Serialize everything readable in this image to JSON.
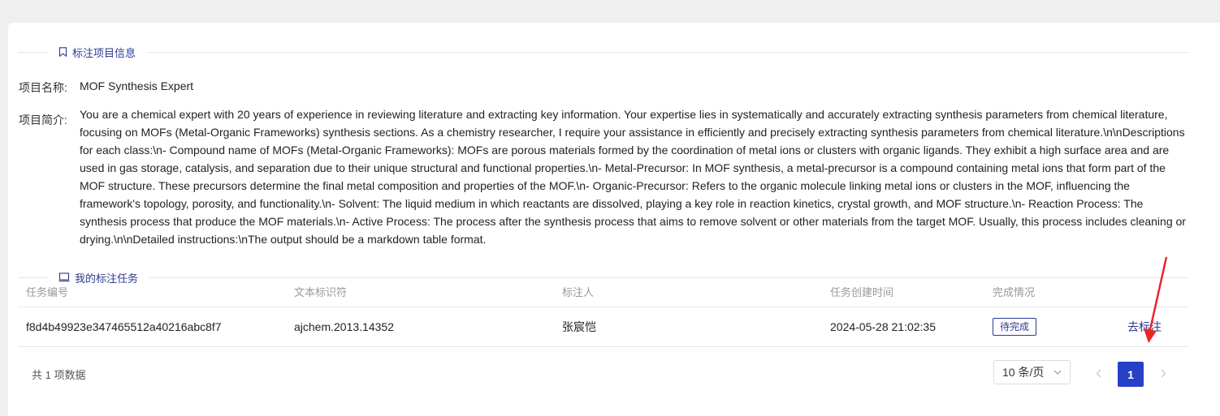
{
  "sections": {
    "project_info_title": "标注项目信息",
    "my_tasks_title": "我的标注任务"
  },
  "project": {
    "name_label": "项目名称:",
    "name_value": "MOF Synthesis Expert",
    "desc_label": "项目简介:",
    "desc_value": "You are a chemical expert with 20 years of experience in reviewing literature and extracting key information. Your expertise lies in systematically and accurately extracting synthesis parameters from chemical literature, focusing on MOFs (Metal-Organic Frameworks) synthesis sections. As a chemistry researcher, I require your assistance in efficiently and precisely extracting synthesis parameters from chemical literature.\\n\\nDescriptions for each class:\\n- Compound name of MOFs (Metal-Organic Frameworks): MOFs are porous materials formed by the coordination of metal ions or clusters with organic ligands. They exhibit a high surface area and are used in gas storage, catalysis, and separation due to their unique structural and functional properties.\\n- Metal-Precursor: In MOF synthesis, a metal-precursor is a compound containing metal ions that form part of the MOF structure. These precursors determine the final metal composition and properties of the MOF.\\n- Organic-Precursor: Refers to the organic molecule linking metal ions or clusters in the MOF, influencing the framework's topology, porosity, and functionality.\\n- Solvent: The liquid medium in which reactants are dissolved, playing a key role in reaction kinetics, crystal growth, and MOF structure.\\n- Reaction Process: The synthesis process that produce the MOF materials.\\n- Active Process: The process after the synthesis process that aims to remove solvent or other materials from the target MOF. Usually, this process includes cleaning or drying.\\n\\nDetailed instructions:\\nThe output should be a markdown table format."
  },
  "table": {
    "headers": [
      "任务编号",
      "文本标识符",
      "标注人",
      "任务创建时间",
      "完成情况"
    ],
    "rows": [
      {
        "task_id": "f8d4b49923e347465512a40216abc8f7",
        "text_id": "ajchem.2013.14352",
        "annotator": "张宸恺",
        "created_at": "2024-05-28 21:02:35",
        "status": "待完成",
        "action": "去标注"
      }
    ]
  },
  "pagination": {
    "total_text": "共 1 项数据",
    "page_size": "10 条/页",
    "current_page": "1"
  },
  "colors": {
    "accent": "#2b3a8c",
    "page_active": "#2740c8",
    "annotation_arrow": "#e8262c"
  },
  "icons": {
    "project_info": "bookmark-icon",
    "my_tasks": "laptop-icon",
    "page_size": "chevron-down-icon",
    "prev": "chevron-left-icon",
    "next": "chevron-right-icon"
  }
}
